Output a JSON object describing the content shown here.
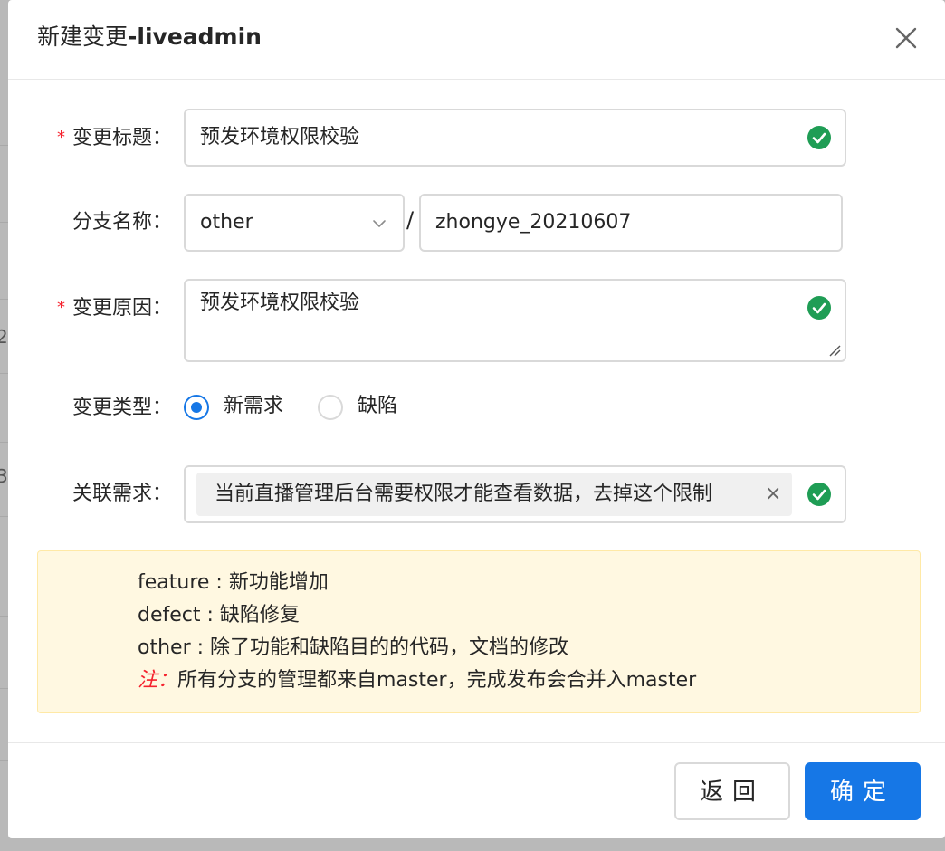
{
  "dialog": {
    "title_prefix": "新建变更",
    "title_suffix": "-liveadmin"
  },
  "form": {
    "title_label": "变更标题：",
    "title_value": "预发环境权限校验",
    "branch_label": "分支名称：",
    "branch_type": "other",
    "branch_separator": "/",
    "branch_name": "zhongye_20210607",
    "reason_label": "变更原因：",
    "reason_value": "预发环境权限校验",
    "type_label": "变更类型：",
    "type_options": [
      "新需求",
      "缺陷"
    ],
    "type_selected": "新需求",
    "related_label": "关联需求：",
    "related_tag": "当前直播管理后台需要权限才能查看数据，去掉这个限制",
    "tag_close_glyph": "×",
    "required_marker": "*"
  },
  "notice": {
    "line1": "feature : 新功能增加",
    "line2": "defect : 缺陷修复",
    "line3": "other : 除了功能和缺陷目的的代码，文档的修改",
    "note_prefix": "注：",
    "note_text": "所有分支的管理都来自master，完成发布会合并入master"
  },
  "footer": {
    "back_label": "返回",
    "ok_label": "确定"
  },
  "background": {
    "partial_chars": [
      "2",
      "3"
    ]
  },
  "colors": {
    "primary": "#1677e6",
    "success": "#1f9d55",
    "required": "#f5222d",
    "notice_bg": "#fff8e1"
  },
  "icons": {
    "close": "close-icon",
    "check": "check-circle-icon",
    "dropdown": "chevron-down-icon"
  }
}
